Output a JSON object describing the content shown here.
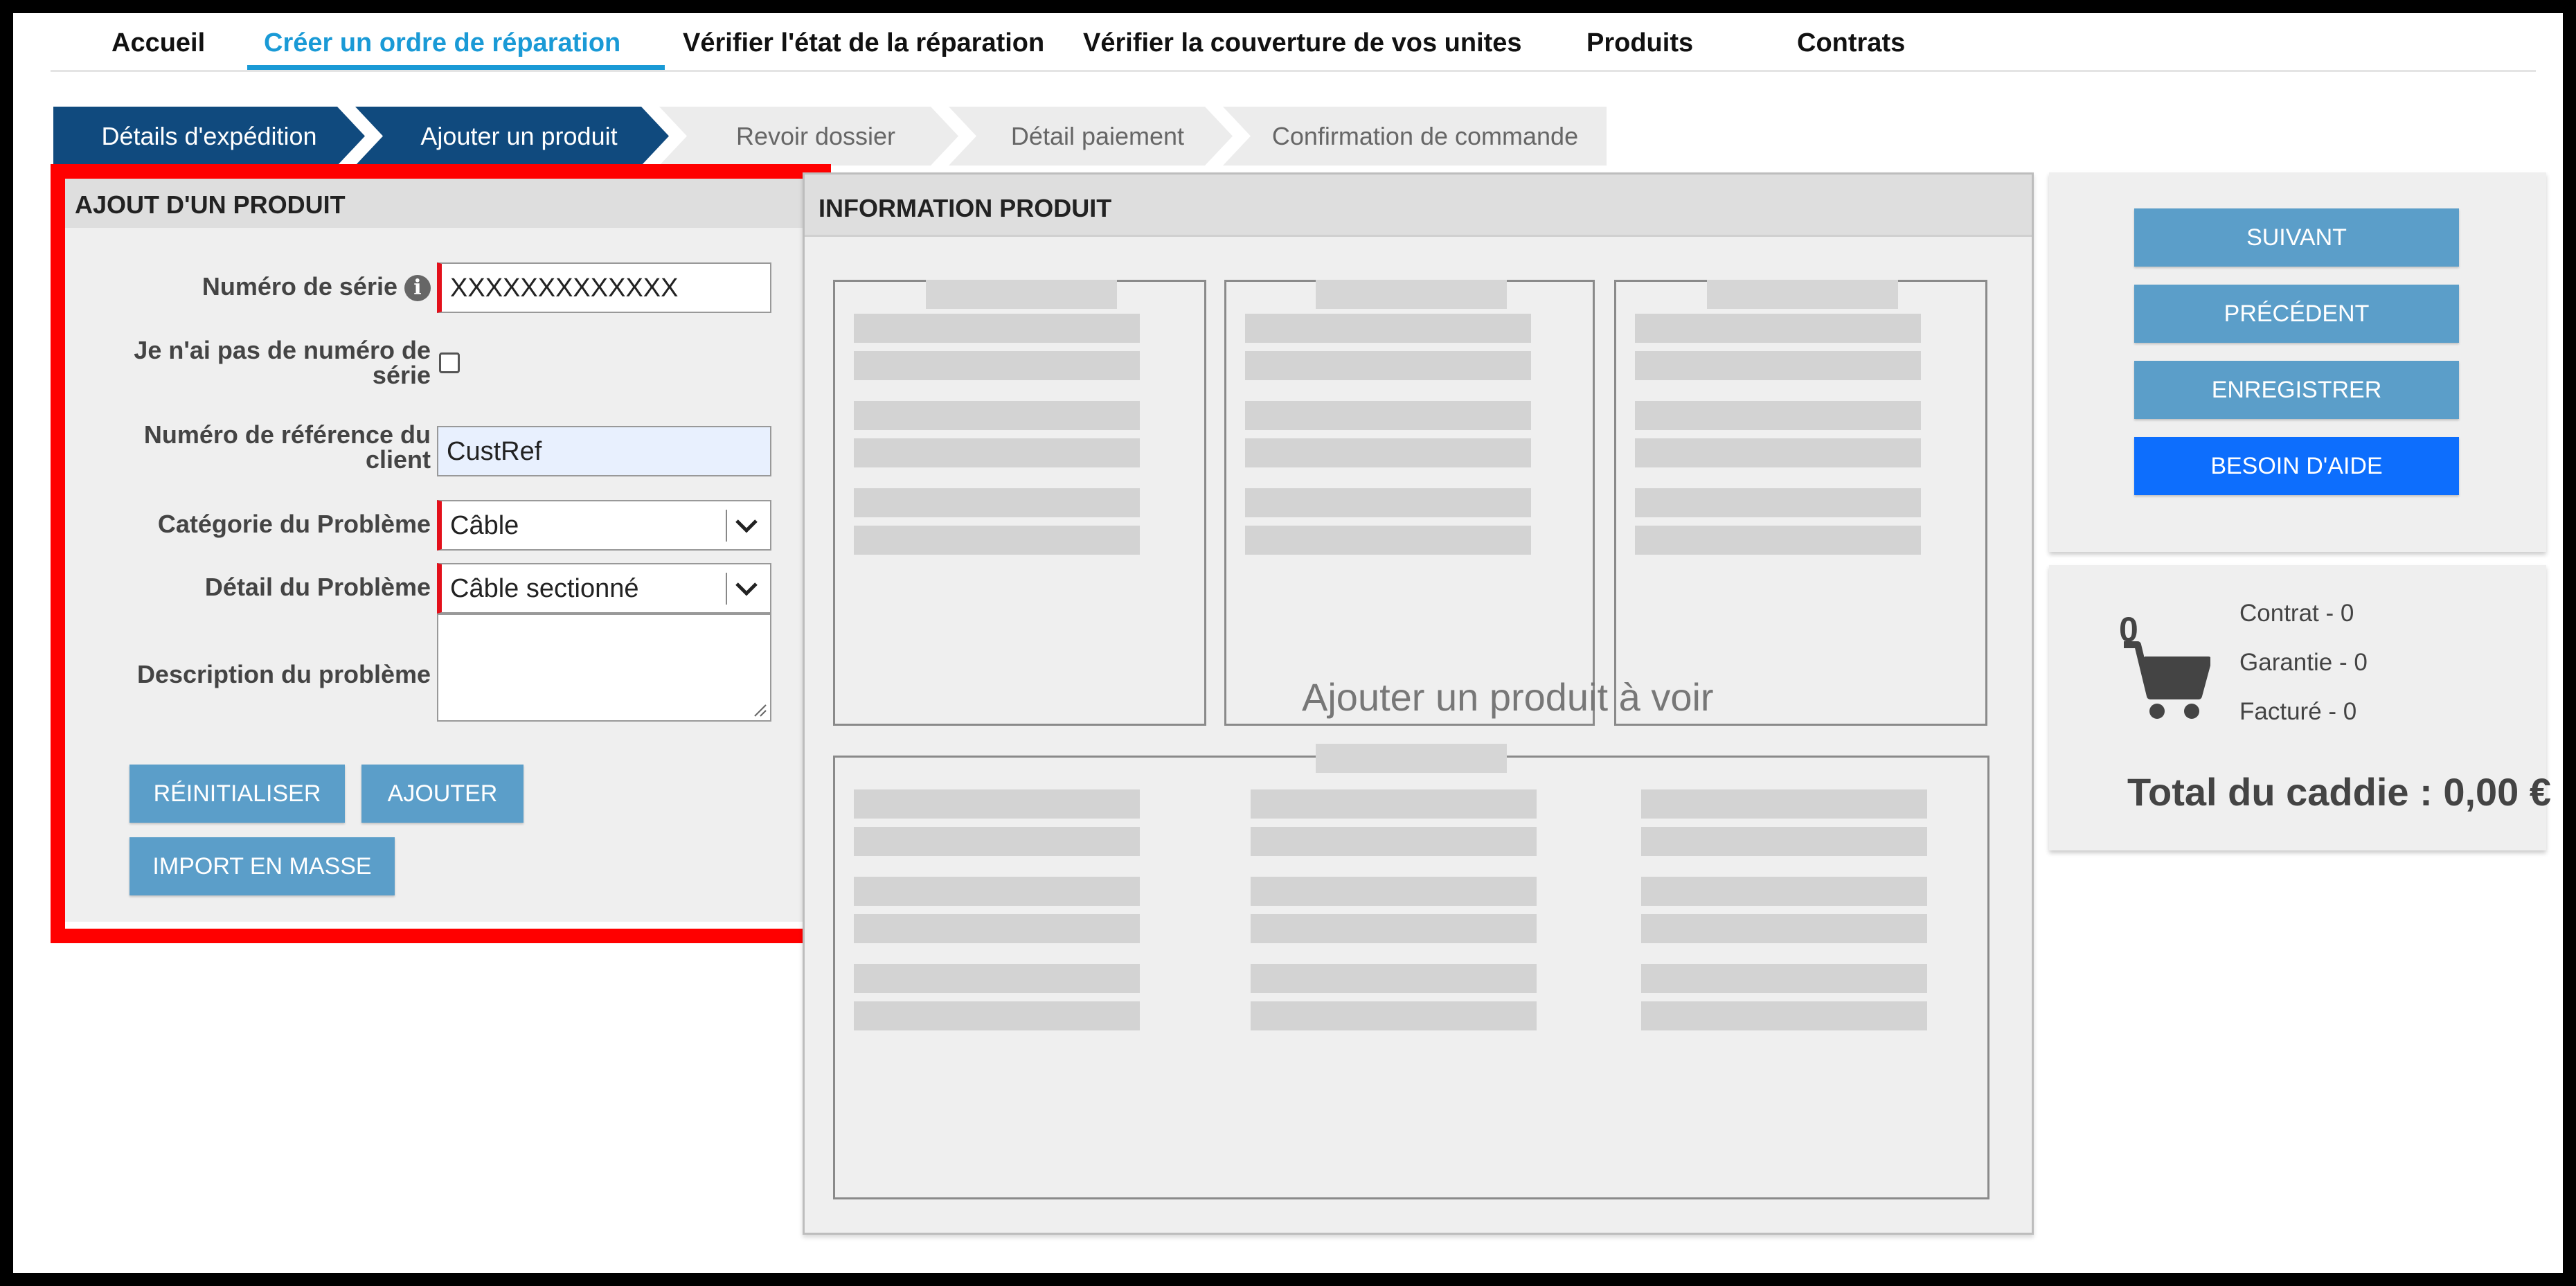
{
  "nav": {
    "items": [
      {
        "label": "Accueil"
      },
      {
        "label": "Créer un ordre de réparation"
      },
      {
        "label": "Vérifier l'état de la réparation"
      },
      {
        "label": "Vérifier la couverture de vos unites"
      },
      {
        "label": "Produits"
      },
      {
        "label": "Contrats"
      }
    ],
    "active_index": 1
  },
  "steps": [
    {
      "label": "Détails d'expédition",
      "state": "done"
    },
    {
      "label": "Ajouter un produit",
      "state": "current"
    },
    {
      "label": "Revoir dossier",
      "state": "todo"
    },
    {
      "label": "Détail paiement",
      "state": "todo"
    },
    {
      "label": "Confirmation de commande",
      "state": "todo"
    }
  ],
  "add_product": {
    "title": "AJOUT D'UN PRODUIT",
    "serial_label": "Numéro de série",
    "serial_value": "XXXXXXXXXXXXX",
    "no_serial_label_1": "Je n'ai pas de numéro de",
    "no_serial_label_2": "série",
    "no_serial_checked": false,
    "ref_label_1": "Numéro de référence du",
    "ref_label_2": "client",
    "ref_value": "CustRef",
    "category_label": "Catégorie du Problème",
    "category_value": "Câble",
    "detail_label": "Détail du Problème",
    "detail_value": "Câble sectionné",
    "description_label": "Description du problème",
    "description_value": "",
    "reset_button": "RÉINITIALISER",
    "add_button": "AJOUTER",
    "bulk_button": "IMPORT EN MASSE"
  },
  "product_info": {
    "title": "INFORMATION PRODUIT",
    "placeholder": "Ajouter un produit à voir"
  },
  "actions": {
    "next": "SUIVANT",
    "previous": "PRÉCÉDENT",
    "save": "ENREGISTRER",
    "help": "BESOIN D'AIDE"
  },
  "cart": {
    "count": "0",
    "contract": "Contrat - 0",
    "warranty": "Garantie - 0",
    "billed": "Facturé - 0",
    "total": "Total du caddie : 0,00 €",
    "icon": "shopping-cart-icon"
  },
  "colors": {
    "accent": "#1a9ad6",
    "step_done": "#104a7e",
    "button": "#5b9ec9",
    "help_button": "#0d6efd",
    "highlight": "#ff0000",
    "required": "#e3101b"
  }
}
